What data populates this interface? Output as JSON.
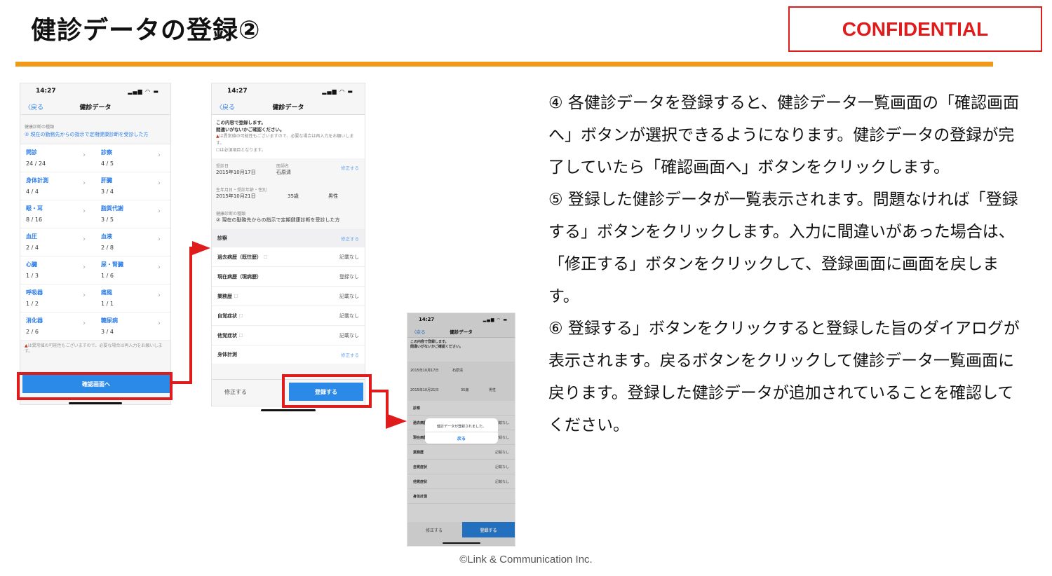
{
  "header": {
    "title": "健診データの登録②",
    "confidential": "CONFIDENTIAL"
  },
  "phone1": {
    "time": "14:27",
    "back": "戻る",
    "title": "健診データ",
    "type_label": "健康診断の種類",
    "type_value": "② 現在の勤務先からの指示で定期健康診断を受診した方",
    "items": [
      {
        "name": "問診",
        "count": "24 / 24"
      },
      {
        "name": "診察",
        "count": "4 / 5"
      },
      {
        "name": "身体計測",
        "count": "4 / 4"
      },
      {
        "name": "肝臓",
        "count": "3 / 4"
      },
      {
        "name": "眼・耳",
        "count": "8 / 16"
      },
      {
        "name": "脂質代謝",
        "count": "3 / 5"
      },
      {
        "name": "血圧",
        "count": "2 / 4"
      },
      {
        "name": "血液",
        "count": "2 / 8"
      },
      {
        "name": "心臓",
        "count": "1 / 3"
      },
      {
        "name": "尿・腎臓",
        "count": "1 / 6"
      },
      {
        "name": "呼吸器",
        "count": "1 / 2"
      },
      {
        "name": "痛風",
        "count": "1 / 1"
      },
      {
        "name": "消化器",
        "count": "2 / 6"
      },
      {
        "name": "糖尿病",
        "count": "3 / 4"
      }
    ],
    "warning": "は異常値の可能性もございますので、必要な場合は再入力をお願いします。",
    "confirm_button": "確認画面へ"
  },
  "phone2": {
    "time": "14:27",
    "back": "戻る",
    "title": "健診データ",
    "notice1": "この内容で登録します。",
    "notice2": "間違いがないかご確認ください。",
    "warn_note": "は異常値の可能性もございますので、必要な場合は再入力をお願いします。",
    "required_note": "は必須項目となります。",
    "date_label": "受診日",
    "date_value": "2015年10月17日",
    "hospital_label": "医師名",
    "hospital_value": "石原清",
    "edit": "修正する",
    "birth_label": "生年月日・受診年齢・性別",
    "birth_value": "2015年10月21日",
    "age_value": "35歳",
    "sex_value": "男性",
    "type_label": "健康診断の種類",
    "type_value": "② 現在の勤務先からの指示で定期健康診断を受診した方",
    "section": "診察",
    "rows": [
      {
        "label": "過去病歴（既往歴）",
        "value": "記載なし"
      },
      {
        "label": "現在病歴（現病歴）",
        "value": "登録なし"
      },
      {
        "label": "業務歴",
        "value": "記載なし"
      },
      {
        "label": "自覚症状",
        "value": "記載なし"
      },
      {
        "label": "他覚症状",
        "value": "記載なし"
      }
    ],
    "section2": "身体計測",
    "fix_button": "修正する",
    "register_button": "登録する"
  },
  "phone3": {
    "time": "14:27",
    "back": "戻る",
    "title": "健診データ",
    "dialog_text": "健診データが登録されました。",
    "dialog_button": "戻る",
    "fix_button": "修正する",
    "register_button": "登録する"
  },
  "description": [
    "④ 各健診データを登録すると、健診データ一覧画面の「確認画面へ」ボタンが選択できるようになります。健診データの登録が完了していたら「確認画面へ」ボタンをクリックします。",
    "⑤ 登録した健診データが一覧表示されます。問題なければ「登録する」ボタンをクリックします。入力に間違いがあった場合は、「修正する」ボタンをクリックして、登録画面に画面を戻します。",
    "⑥ 登録する」ボタンをクリックすると登録した旨のダイアログが表示されます。戻るボタンをクリックして健診データ一覧画面に戻ります。登録した健診データが追加されていることを確認してください。"
  ],
  "footer": "©Link & Communication Inc."
}
